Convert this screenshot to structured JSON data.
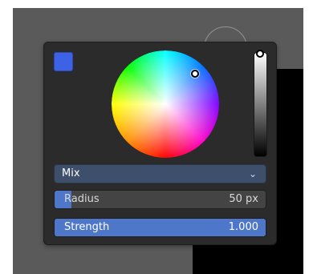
{
  "ui": {
    "color": {
      "swatch_hex": "#3d62e6",
      "wheel_marker": "white",
      "value_level": 1.0
    },
    "blend": {
      "selected": "Mix"
    },
    "radius": {
      "label": "Radius",
      "value": "50 px",
      "fill_fraction": 0.08
    },
    "strength": {
      "label": "Strength",
      "value": "1.000",
      "fill_fraction": 1.0
    },
    "icons": {
      "dropdown": "chevron-down-icon"
    }
  }
}
